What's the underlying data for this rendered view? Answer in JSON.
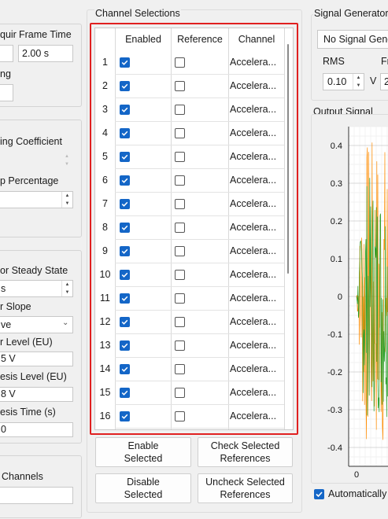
{
  "left_panel": {
    "acquire_label": "quir",
    "frame_time_label": "Frame Time",
    "frame_time_value": "2.00 s",
    "ing_label": "ng",
    "coefficient_label": "ing Coefficient",
    "percentage_label": "p Percentage",
    "steady_state_label": "or Steady State",
    "steady_state_value": "s",
    "slope_label": "r Slope",
    "slope_value": "ve",
    "level_label": "r Level (EU)",
    "level_value": "5 V",
    "hysteresis_label": "esis Level (EU)",
    "hysteresis_value": "8 V",
    "hyst_time_label": "esis Time (s)",
    "hyst_time_value": "0",
    "channels_label": "Channels"
  },
  "channel_selections": {
    "title": "Channel Selections",
    "columns": [
      "Enabled",
      "Reference",
      "Channel"
    ],
    "rows": [
      {
        "num": "1",
        "enabled": true,
        "reference": false,
        "channel": "Accelera..."
      },
      {
        "num": "2",
        "enabled": true,
        "reference": false,
        "channel": "Accelera..."
      },
      {
        "num": "3",
        "enabled": true,
        "reference": false,
        "channel": "Accelera..."
      },
      {
        "num": "4",
        "enabled": true,
        "reference": false,
        "channel": "Accelera..."
      },
      {
        "num": "5",
        "enabled": true,
        "reference": false,
        "channel": "Accelera..."
      },
      {
        "num": "6",
        "enabled": true,
        "reference": false,
        "channel": "Accelera..."
      },
      {
        "num": "7",
        "enabled": true,
        "reference": false,
        "channel": "Accelera..."
      },
      {
        "num": "8",
        "enabled": true,
        "reference": false,
        "channel": "Accelera..."
      },
      {
        "num": "9",
        "enabled": true,
        "reference": false,
        "channel": "Accelera..."
      },
      {
        "num": "10",
        "enabled": true,
        "reference": false,
        "channel": "Accelera..."
      },
      {
        "num": "11",
        "enabled": true,
        "reference": false,
        "channel": "Accelera..."
      },
      {
        "num": "12",
        "enabled": true,
        "reference": false,
        "channel": "Accelera..."
      },
      {
        "num": "13",
        "enabled": true,
        "reference": false,
        "channel": "Accelera..."
      },
      {
        "num": "14",
        "enabled": true,
        "reference": false,
        "channel": "Accelera..."
      },
      {
        "num": "15",
        "enabled": true,
        "reference": false,
        "channel": "Accelera..."
      },
      {
        "num": "16",
        "enabled": true,
        "reference": false,
        "channel": "Accelera..."
      }
    ],
    "enable_selected": "Enable\nSelected",
    "disable_selected": "Disable\nSelected",
    "check_refs": "Check Selected\nReferences",
    "uncheck_refs": "Uncheck Selected\nReferences"
  },
  "signal_generator": {
    "title": "Signal Generator",
    "source_value": "No Signal Gene",
    "rms_label": "RMS",
    "rms_value": "0.10",
    "rms_unit": "V",
    "freq_label": "Fr",
    "freq_value": "2",
    "output_title": "Output Signal",
    "auto_label": "Automatically",
    "auto_checked": true
  },
  "chart_data": {
    "type": "line",
    "title": "",
    "xlabel": "",
    "ylabel": "",
    "x_ticks": [
      "0"
    ],
    "y_ticks": [
      "0.4",
      "0.3",
      "0.2",
      "0.1",
      "0",
      "-0.1",
      "-0.2",
      "-0.3",
      "-0.4"
    ],
    "ylim": [
      -0.45,
      0.45
    ],
    "grid": true,
    "series_colors": [
      "#ff8c00",
      "#2ca02c"
    ]
  },
  "colors": {
    "accent": "#1466c7",
    "highlight_border": "#e02020"
  }
}
